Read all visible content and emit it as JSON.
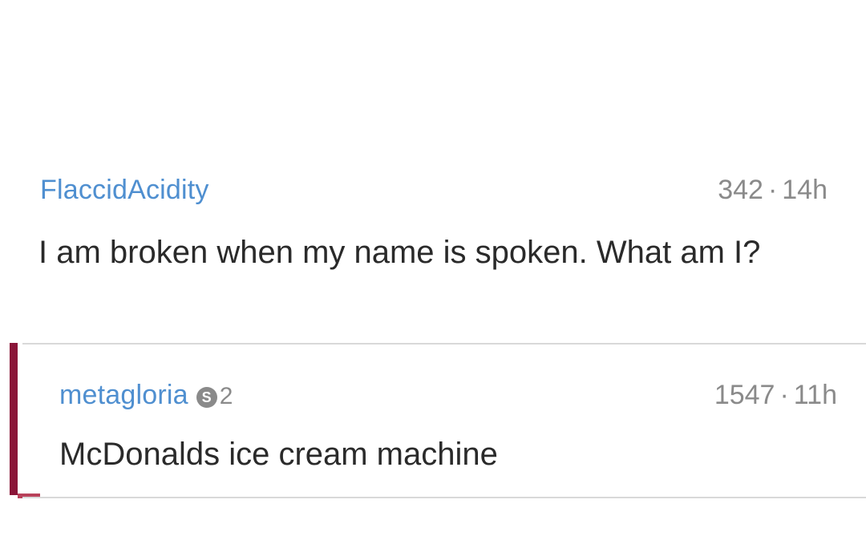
{
  "comment": {
    "username": "FlaccidAcidity",
    "score": "342",
    "separator": "·",
    "age": "14h",
    "text": "I am broken when my name is spoken. What am I?"
  },
  "reply": {
    "username": "metagloria",
    "badge_icon": "S",
    "badge_count": "2",
    "score": "1547",
    "separator": "·",
    "age": "11h",
    "text": "McDonalds ice cream machine",
    "thread_bar_color": "#8a1538"
  },
  "colors": {
    "username": "#4f8fd0",
    "meta": "#8a8a8a",
    "body_text": "#2a2a2a",
    "divider": "#d9d9d9"
  }
}
